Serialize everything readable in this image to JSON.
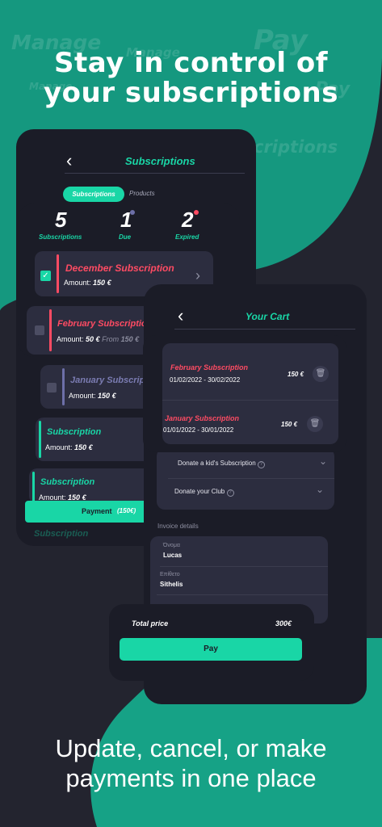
{
  "marketing": {
    "headline_line1": "Stay in control of",
    "headline_line2": "your subscriptions",
    "tagline_line1": "Update, cancel, or make",
    "tagline_line2": "payments in one place",
    "ghost_words": [
      "Manage",
      "Manage",
      "Manage",
      "Pay",
      "Pay",
      "criptions"
    ]
  },
  "colors": {
    "accent": "#19d6a6",
    "danger": "#ff4b63",
    "background": "#23242f",
    "panel": "#1b1c27",
    "card": "#2c2d3f"
  },
  "subscriptions_screen": {
    "title": "Subscriptions",
    "tabs": [
      "Subscriptions",
      "Products"
    ],
    "active_tab": "Subscriptions",
    "stats": [
      {
        "value": "5",
        "label": "Subscriptions"
      },
      {
        "value": "1",
        "label": "Due",
        "dot_color": "#6d6fa8"
      },
      {
        "value": "2",
        "label": "Expired",
        "dot_color": "#ff4b63"
      }
    ],
    "items": [
      {
        "name": "December Subscription",
        "amount_label": "Amount:",
        "amount": "150 €",
        "checked": true
      },
      {
        "name": "February Subscription",
        "amount_label": "Amount:",
        "amount": "50 €",
        "from_label": "From",
        "from_amount": "150 €",
        "checked": false
      },
      {
        "name": "January Subscripti",
        "amount_label": "Amount:",
        "amount": "150 €",
        "checked": false
      },
      {
        "name": "Subscription",
        "amount_label": "Amount:",
        "amount": "150 €"
      },
      {
        "name": "Subscription",
        "amount_label": "Amount:",
        "amount": "150 €"
      },
      {
        "name": "Subscription"
      }
    ],
    "payment_button": "Payment",
    "payment_amount": "(150€)"
  },
  "cart_screen": {
    "title": "Your Cart",
    "donations": [
      "Donate a kid's Subscription",
      "Donate your Club"
    ],
    "invoice_title": "Invoice details",
    "fields": [
      {
        "label": "Όνομα",
        "value": "Lucas"
      },
      {
        "label": "Επίθετο",
        "value": "Sithelis"
      }
    ]
  },
  "cart_popup": {
    "items": [
      {
        "name": "February Subscription",
        "dates": "01/02/2022 - 30/02/2022",
        "price": "150 €"
      },
      {
        "name": "January Subscription",
        "dates": "01/01/2022 - 30/01/2022",
        "price": "150 €"
      }
    ]
  },
  "total_card": {
    "label": "Total price",
    "value": "300€",
    "pay_button": "Pay"
  }
}
